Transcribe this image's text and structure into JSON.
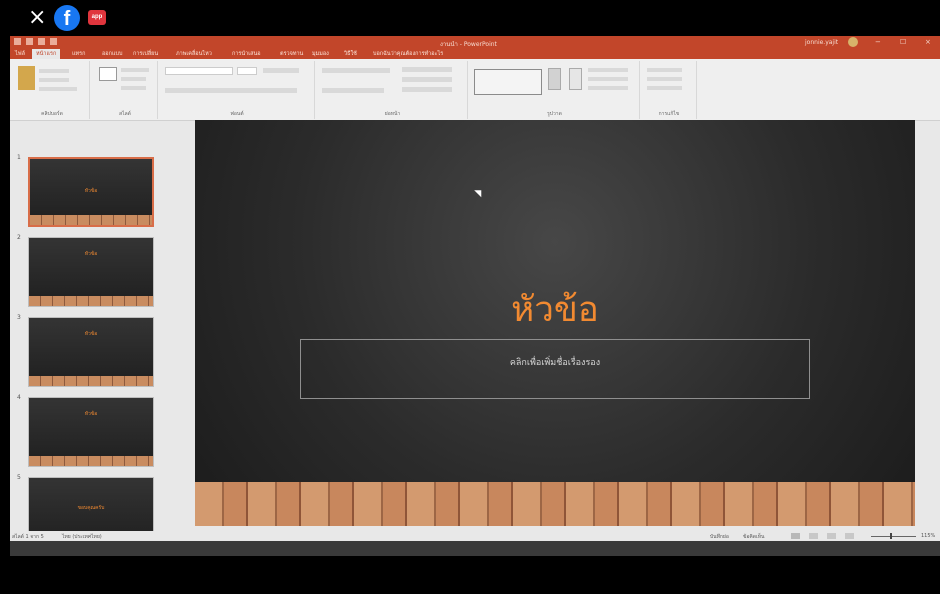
{
  "overlay": {
    "close_icon": "close-icon",
    "facebook_icon": "facebook-icon",
    "red_badge_icon": "red-badge-icon"
  },
  "window": {
    "title": "งานนำ - PowerPoint",
    "account": "jonnie.yajit",
    "minimize": "−",
    "restore": "☐",
    "close": "×"
  },
  "tabs": [
    "ไฟล์",
    "หน้าแรก",
    "แทรก",
    "ออกแบบ",
    "การเปลี่ยน",
    "ภาพเคลื่อนไหว",
    "การนำเสนอ",
    "ตรวจทาน",
    "มุมมอง",
    "วิธีใช้",
    "บอกฉันว่าคุณต้องการทำอะไร"
  ],
  "ribbon_groups": [
    "คลิปบอร์ด",
    "สไลด์",
    "ฟอนต์",
    "ย่อหน้า",
    "รูปวาด",
    "การแก้ไข"
  ],
  "slides": [
    {
      "number": "1",
      "title": "หัวข้อ"
    },
    {
      "number": "2",
      "title": "หัวข้อ"
    },
    {
      "number": "3",
      "title": "หัวข้อ"
    },
    {
      "number": "4",
      "title": "หัวข้อ"
    },
    {
      "number": "5",
      "title": "ขอบคุณครับ"
    }
  ],
  "main_slide": {
    "title": "หัวข้อ",
    "subtitle": "คลิกเพื่อเพิ่มชื่อเรื่องรอง"
  },
  "status": {
    "slide": "สไลด์ 1 จาก 5",
    "language": "ไทย (ประเทศไทย)",
    "notes": "บันทึกย่อ",
    "comments": "ข้อคิดเห็น",
    "zoom": "115%"
  },
  "colors": {
    "ribbon_red": "#c2462a",
    "accent_orange": "#f28a31",
    "slide_dark": "#2f2f2f"
  }
}
